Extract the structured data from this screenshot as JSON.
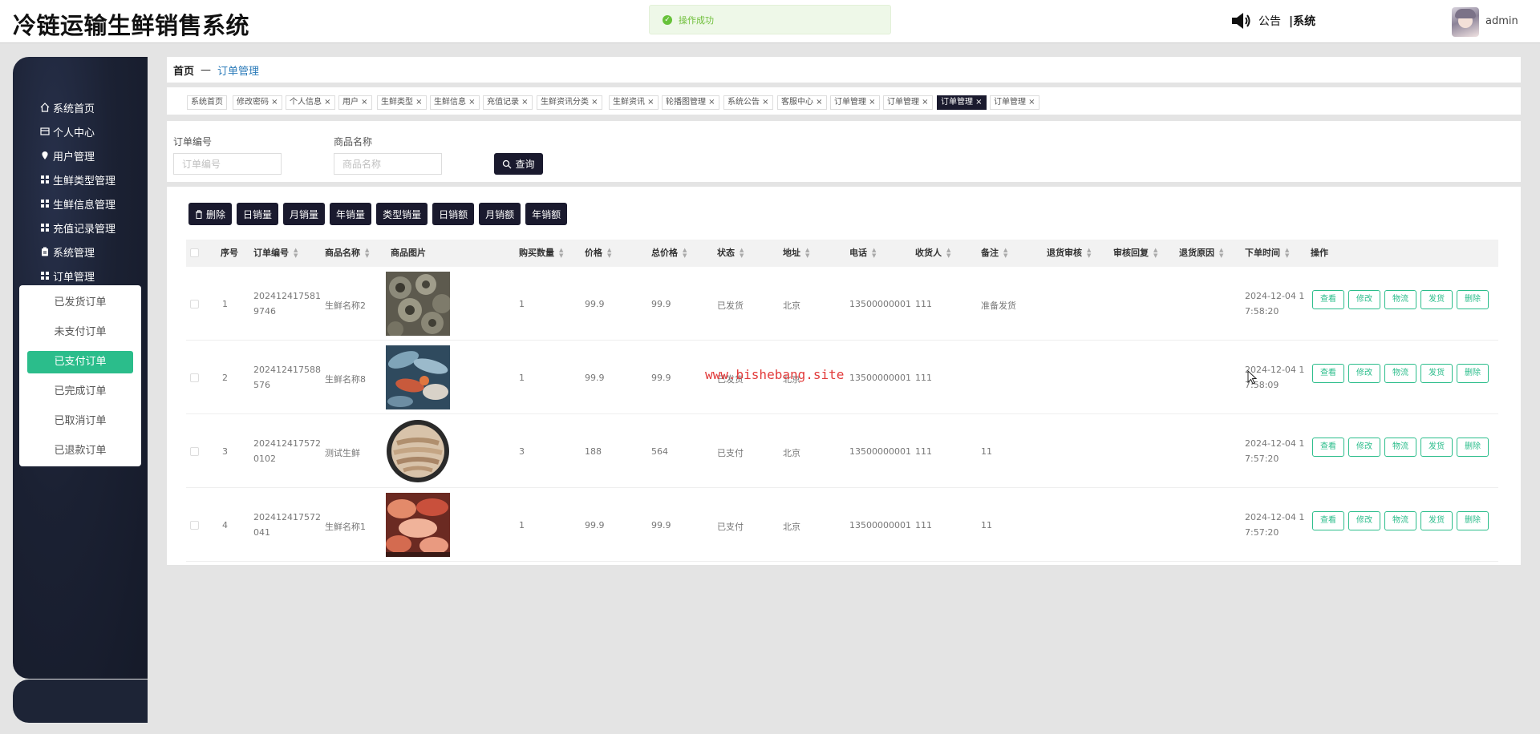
{
  "header": {
    "app_title": "冷链运输生鲜销售系统",
    "toast_text": "操作成功",
    "notice_label": "公告",
    "notice_system": "|系统",
    "username": "admin"
  },
  "sidebar": {
    "items": [
      {
        "label": "系统首页",
        "icon": "home-icon"
      },
      {
        "label": "个人中心",
        "icon": "card-icon"
      },
      {
        "label": "用户管理",
        "icon": "pin-icon"
      },
      {
        "label": "生鲜类型管理",
        "icon": "grid-icon"
      },
      {
        "label": "生鲜信息管理",
        "icon": "grid-icon"
      },
      {
        "label": "充值记录管理",
        "icon": "grid-icon"
      },
      {
        "label": "系统管理",
        "icon": "clipboard-icon"
      },
      {
        "label": "订单管理",
        "icon": "grid-icon"
      }
    ],
    "submenu": [
      {
        "label": "已发货订单"
      },
      {
        "label": "未支付订单"
      },
      {
        "label": "已支付订单",
        "active": true
      },
      {
        "label": "已完成订单"
      },
      {
        "label": "已取消订单"
      },
      {
        "label": "已退款订单"
      }
    ]
  },
  "breadcrumb": {
    "home": "首页",
    "separator": "—",
    "current": "订单管理"
  },
  "tags": [
    {
      "label": "系统首页"
    },
    {
      "label": "修改密码 ×"
    },
    {
      "label": "个人信息 ×"
    },
    {
      "label": "用户 ×"
    },
    {
      "label": "生鲜类型 ×"
    },
    {
      "label": "生鲜信息 ×"
    },
    {
      "label": "充值记录 ×"
    },
    {
      "label": "生鲜资讯分类 ×"
    },
    {
      "label": "生鲜资讯 ×"
    },
    {
      "label": "轮播图管理 ×"
    },
    {
      "label": "系统公告 ×"
    },
    {
      "label": "客服中心 ×"
    },
    {
      "label": "订单管理 ×"
    },
    {
      "label": "订单管理 ×"
    },
    {
      "label": "订单管理 ×",
      "active": true
    },
    {
      "label": "订单管理 ×"
    }
  ],
  "search": {
    "order_no_label": "订单编号",
    "order_no_placeholder": "订单编号",
    "product_label": "商品名称",
    "product_placeholder": "商品名称",
    "query_label": "查询"
  },
  "actions": [
    "删除",
    "日销量",
    "月销量",
    "年销量",
    "类型销量",
    "日销额",
    "月销额",
    "年销额"
  ],
  "table": {
    "columns": [
      "序号",
      "订单编号",
      "商品名称",
      "商品图片",
      "购买数量",
      "价格",
      "总价格",
      "状态",
      "地址",
      "电话",
      "收货人",
      "备注",
      "退货审核",
      "审核回复",
      "退货原因",
      "下单时间",
      "操作"
    ],
    "rows": [
      {
        "idx": "1",
        "order_no_1": "202412417581",
        "order_no_2": "9746",
        "product": "生鲜名称2",
        "image": "shellfish",
        "qty": "1",
        "price": "99.9",
        "total": "99.9",
        "status": "已发货",
        "address": "北京",
        "phone": "13500000001",
        "receiver": "111",
        "remark": "准备发货",
        "time_1": "2024-12-04 1",
        "time_2": "7:58:20"
      },
      {
        "idx": "2",
        "order_no_1": "202412417588",
        "order_no_2": "576",
        "product": "生鲜名称8",
        "image": "seafood",
        "qty": "1",
        "price": "99.9",
        "total": "99.9",
        "status": "已发货",
        "address": "北京",
        "phone": "13500000001",
        "receiver": "111",
        "remark": "",
        "time_1": "2024-12-04 1",
        "time_2": "7:58:09"
      },
      {
        "idx": "3",
        "order_no_1": "202412417572",
        "order_no_2": "0102",
        "product": "测试生鲜",
        "image": "shrimp-plate",
        "qty": "3",
        "price": "188",
        "total": "564",
        "status": "已支付",
        "address": "北京",
        "phone": "13500000001",
        "receiver": "111",
        "remark": "11",
        "time_1": "2024-12-04 1",
        "time_2": "7:57:20"
      },
      {
        "idx": "4",
        "order_no_1": "202412417572",
        "order_no_2": "041",
        "product": "生鲜名称1",
        "image": "fish-fillet",
        "qty": "1",
        "price": "99.9",
        "total": "99.9",
        "status": "已支付",
        "address": "北京",
        "phone": "13500000001",
        "receiver": "111",
        "remark": "11",
        "time_1": "2024-12-04 1",
        "time_2": "7:57:20"
      }
    ],
    "row_buttons": [
      "查看",
      "修改",
      "物流",
      "发货",
      "删除"
    ]
  },
  "watermark": "www.bishebang.site",
  "colors": {
    "primary_dark": "#1a1a2e",
    "accent_green": "#2bbd8b",
    "sidebar_bg": "#1b2133",
    "watermark_red": "#e23b3b"
  }
}
